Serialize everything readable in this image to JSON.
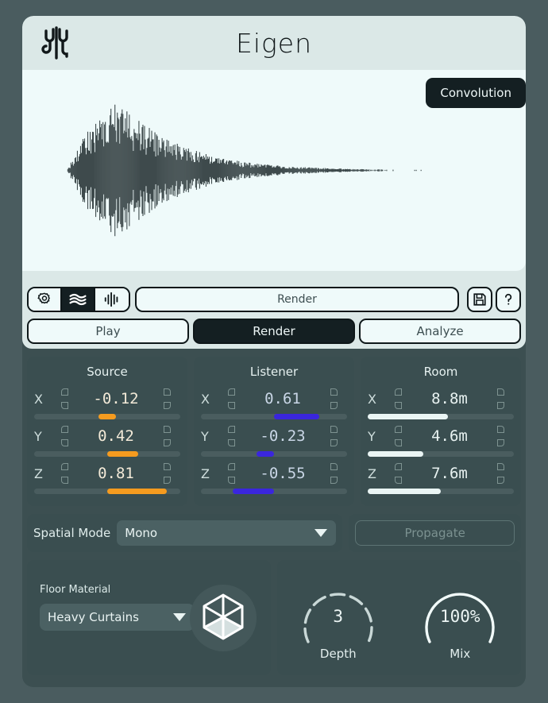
{
  "app": {
    "title": "Eigen",
    "logo_icon": "eigen-waveform-logo-icon"
  },
  "display": {
    "mode_badge": "Convolution",
    "waveform_name": "impulse-response-waveform"
  },
  "toolbar": {
    "icons": [
      {
        "name": "gear-icon",
        "label": "Settings",
        "active": false
      },
      {
        "name": "waves-icon",
        "label": "Waves",
        "active": true
      },
      {
        "name": "waveform-icon",
        "label": "Waveform",
        "active": false
      }
    ],
    "field_value": "Render",
    "save_icon": "save-disk-icon",
    "help_icon": "help-question-icon"
  },
  "tabs": [
    {
      "label": "Play",
      "active": false
    },
    {
      "label": "Render",
      "active": true
    },
    {
      "label": "Analyze",
      "active": false
    }
  ],
  "vectors": [
    {
      "title": "Source",
      "accent": "#f59b1f",
      "rows": [
        {
          "axis": "X",
          "value": "-0.12",
          "fill_start": 44,
          "fill_end": 56
        },
        {
          "axis": "Y",
          "value": "0.42",
          "fill_start": 50,
          "fill_end": 71
        },
        {
          "axis": "Z",
          "value": "0.81",
          "fill_start": 50,
          "fill_end": 91
        }
      ]
    },
    {
      "title": "Listener",
      "accent": "#3a26dd",
      "rows": [
        {
          "axis": "X",
          "value": "0.61",
          "fill_start": 50,
          "fill_end": 81
        },
        {
          "axis": "Y",
          "value": "-0.23",
          "fill_start": 38,
          "fill_end": 50
        },
        {
          "axis": "Z",
          "value": "-0.55",
          "fill_start": 22,
          "fill_end": 50
        }
      ]
    },
    {
      "title": "Room",
      "accent": "#eaf5f4",
      "rows": [
        {
          "axis": "X",
          "value": "8.8m",
          "fill_start": 0,
          "fill_end": 55
        },
        {
          "axis": "Y",
          "value": "4.6m",
          "fill_start": 0,
          "fill_end": 38
        },
        {
          "axis": "Z",
          "value": "7.6m",
          "fill_start": 0,
          "fill_end": 50
        }
      ]
    }
  ],
  "spatial": {
    "label": "Spatial Mode",
    "selected": "Mono",
    "caret_icon": "chevron-down-icon",
    "propagate_label": "Propagate"
  },
  "material": {
    "label": "Floor Material",
    "selected": "Heavy Curtains",
    "caret_icon": "chevron-down-icon",
    "cube_icon": "room-cube-icon"
  },
  "knobs": [
    {
      "label": "Depth",
      "value": "3",
      "arc_pct": 100,
      "dashed": true
    },
    {
      "label": "Mix",
      "value": "100%",
      "arc_pct": 100,
      "dashed": false
    }
  ]
}
